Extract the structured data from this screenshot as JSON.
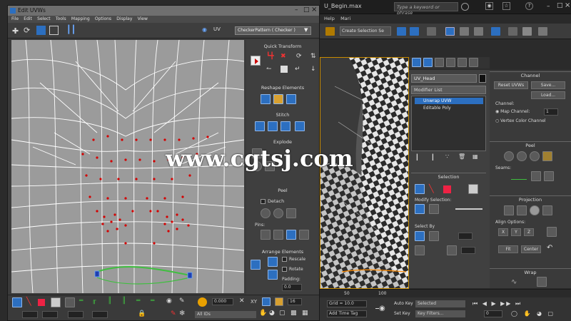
{
  "app": {
    "title": "U_Begin.max",
    "search_placeholder": "Type a keyword or phrase",
    "menu": [
      "Help",
      "Mari"
    ],
    "selection_set": "Create Selection Se",
    "object_name": "UV_Head",
    "modifier_list": "Modifier List",
    "stack": [
      {
        "label": "Unwrap UVW",
        "active": true
      },
      {
        "label": "Editable Poly",
        "active": false
      }
    ],
    "rollouts": {
      "selection": "Selection",
      "modify_selection": "Modify Selection:",
      "select_by": "Select By"
    },
    "channel": {
      "title": "Channel",
      "reset_uvws": "Reset UVWs",
      "save": "Save...",
      "load": "Load...",
      "channel_label": "Channel:",
      "map_channel": "Map Channel:",
      "map_channel_value": "1",
      "vertex_color": "Vertex Color Channel"
    },
    "peel": {
      "title": "Peel",
      "seams": "Seams:"
    },
    "projection": {
      "title": "Projection",
      "align_options": "Align Options:",
      "axes": [
        "X",
        "Y",
        "Z"
      ],
      "fit": "Fit",
      "center": "Center"
    },
    "wrap": {
      "title": "Wrap"
    },
    "timeline": [
      "50",
      "100"
    ],
    "status": {
      "grid_label": "Grid = 10.0",
      "add_time_tag": "Add Time Tag",
      "auto_key": "Auto Key",
      "set_key": "Set Key",
      "selected": "Selected",
      "key_filters": "Key Filters...",
      "frame": "0"
    }
  },
  "uvw": {
    "title": "Edit UVWs",
    "menu": [
      "File",
      "Edit",
      "Select",
      "Tools",
      "Mapping",
      "Options",
      "Display",
      "View"
    ],
    "uv_label": "UV",
    "checker": "CheckerPattern ( Checker )",
    "sections": {
      "quick_transform": "Quick Transform",
      "reshape": "Reshape Elements",
      "stitch": "Stitch",
      "explode": "Explode",
      "peel": "Peel",
      "arrange": "Arrange Elements"
    },
    "peel_detach": "Detach",
    "peel_pins": "Pins:",
    "arrange_rescale": "Rescale",
    "arrange_rotate": "Rotate",
    "arrange_padding": "Padding:",
    "arrange_padding_value": "0.0",
    "bottom": {
      "xy_label": "XY",
      "zoom": "16",
      "all_ids": "All IDs",
      "value": "0.000"
    }
  },
  "watermark": "www.cgtsj.com",
  "colors": {
    "canvas": "#9b9b9b",
    "mesh": "#ffffff",
    "vertex": "#d40000",
    "seam": "#3fbf3f",
    "accent_orange": "#c88b00",
    "blue_button": "#2c6fc0"
  }
}
